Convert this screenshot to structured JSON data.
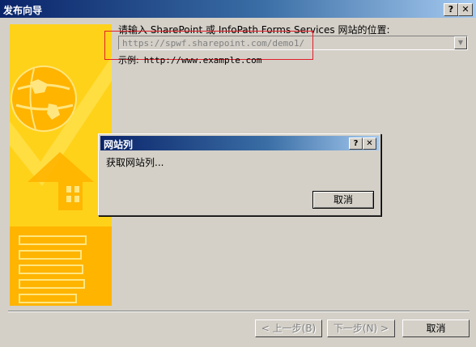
{
  "window": {
    "title": "发布向导",
    "help_label": "?",
    "close_label": "✕"
  },
  "form": {
    "prompt": "请输入 SharePoint 或 InfoPath Forms Services 网站的位置:",
    "url_value": "https://spwf.sharepoint.com/demo1/",
    "example_label": "示例:",
    "example_url": "http://www.example.com"
  },
  "buttons": {
    "back": "< 上一步(B)",
    "next": "下一步(N) >",
    "cancel": "取消"
  },
  "dialog": {
    "title": "网站列",
    "message": "获取网站列...",
    "help_label": "?",
    "close_label": "✕",
    "cancel": "取消"
  },
  "colors": {
    "title_bar": "#0a246a",
    "panel_yellow": "#ffd21a",
    "highlight_red": "#e0202a",
    "face": "#d4d0c8"
  }
}
